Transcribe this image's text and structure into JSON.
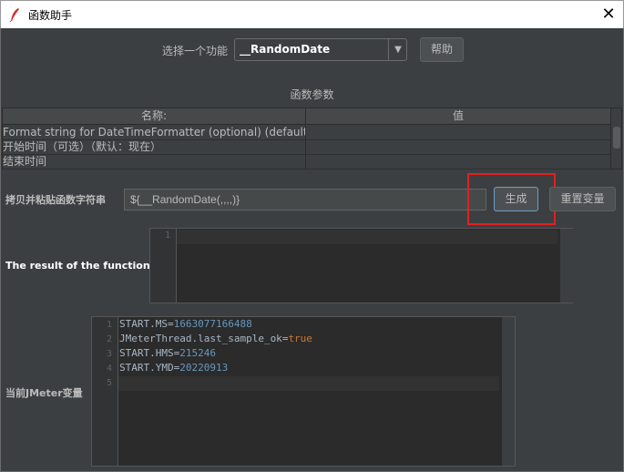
{
  "window": {
    "title": "函数助手",
    "close_glyph": "✕"
  },
  "function_selector": {
    "label": "选择一个功能",
    "selected": "__RandomDate",
    "help_label": "帮助"
  },
  "parameters": {
    "title": "函数参数",
    "columns": [
      "名称:",
      "值"
    ],
    "rows": [
      {
        "name": "Format string for DateTimeFormatter (optional) (default yyyy...",
        "value": ""
      },
      {
        "name": "开始时间（可选）（默认：现在）",
        "value": ""
      },
      {
        "name": "结束时间",
        "value": ""
      }
    ]
  },
  "copy_paste": {
    "label": "拷贝并粘贴函数字符串",
    "value": "${__RandomDate(,,,,)}",
    "generate_label": "生成",
    "reset_label": "重置变量"
  },
  "result": {
    "label": "The result of the function is",
    "line_numbers": [
      "1"
    ],
    "content": ""
  },
  "jmeter_vars": {
    "label": "当前JMeter变量",
    "line_numbers": [
      "1",
      "2",
      "3",
      "4",
      "5"
    ],
    "lines": [
      {
        "key": "START.MS",
        "value": "1663077166488",
        "type": "number"
      },
      {
        "key": "JMeterThread.last_sample_ok",
        "value": "true",
        "type": "keyword"
      },
      {
        "key": "START.HMS",
        "value": "215246",
        "type": "number"
      },
      {
        "key": "START.YMD",
        "value": "20220913",
        "type": "number"
      }
    ]
  },
  "colors": {
    "background": "#3c3f41",
    "editor_bg": "#2b2b2b",
    "number": "#6897bb",
    "keyword": "#cc7832",
    "highlight": "#e02020",
    "focus_border": "#6d9ec4"
  }
}
